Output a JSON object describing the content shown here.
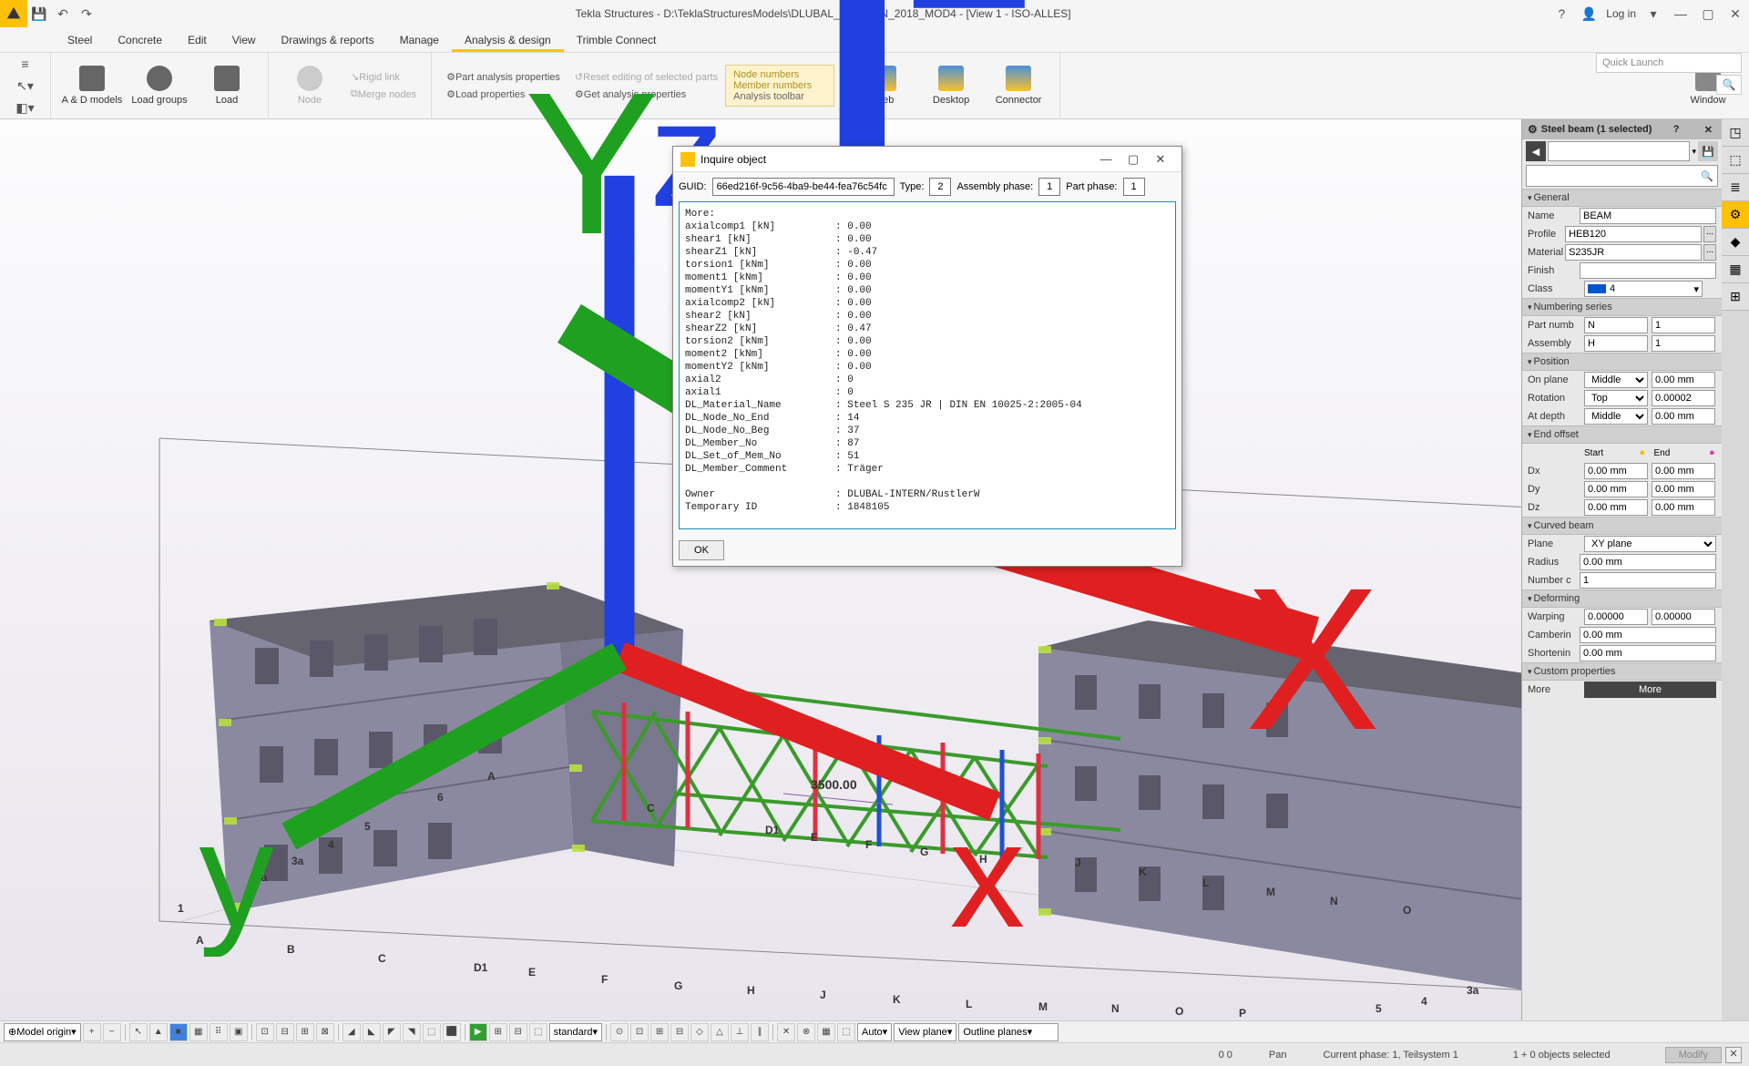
{
  "titlebar": {
    "title": "Tekla Structures - D:\\TeklaStructuresModels\\DLUBAL_SESSION_2018_MOD4 - [View 1 - ISO-ALLES]",
    "login": "Log in"
  },
  "menu": {
    "items": [
      "Steel",
      "Concrete",
      "Edit",
      "View",
      "Drawings & reports",
      "Manage",
      "Analysis & design",
      "Trimble Connect"
    ],
    "active": "Analysis & design"
  },
  "ribbon": {
    "ad_models": "A & D models",
    "load_groups": "Load groups",
    "load": "Load",
    "node": "Node",
    "rigid_link": "Rigid link",
    "merge_nodes": "Merge nodes",
    "part_analysis": "Part analysis properties",
    "load_props": "Load properties",
    "reset_editing": "Reset editing of selected parts",
    "get_analysis": "Get analysis properties",
    "node_numbers": "Node numbers",
    "member_numbers": "Member numbers",
    "analysis_tb": "Analysis toolbar",
    "web": "Web",
    "desktop": "Desktop",
    "connector": "Connector",
    "window": "Window",
    "quick_launch": "Quick Launch"
  },
  "dialog": {
    "title": "Inquire object",
    "guid_label": "GUID:",
    "guid": "66ed216f-9c56-4ba9-be44-fea76c54fc",
    "type_label": "Type:",
    "type": "2",
    "asm_label": "Assembly phase:",
    "asm": "1",
    "part_label": "Part phase:",
    "part": "1",
    "text": "More:\naxialcomp1 [kN]          : 0.00\nshear1 [kN]              : 0.00\nshearZ1 [kN]             : -0.47\ntorsion1 [kNm]           : 0.00\nmoment1 [kNm]            : 0.00\nmomentY1 [kNm]           : 0.00\naxialcomp2 [kN]          : 0.00\nshear2 [kN]              : 0.00\nshearZ2 [kN]             : 0.47\ntorsion2 [kNm]           : 0.00\nmoment2 [kNm]            : 0.00\nmomentY2 [kNm]           : 0.00\naxial2                   : 0\naxial1                   : 0\nDL_Material_Name         : Steel S 235 JR | DIN EN 10025-2:2005-04\nDL_Node_No_End           : 14\nDL_Node_No_Beg           : 37\nDL_Member_No             : 87\nDL_Set_of_Mem_No         : 51\nDL_Member_Comment        : Träger\n\nOwner                    : DLUBAL-INTERN/RustlerW\nTemporary ID             : 1848105",
    "ok": "OK"
  },
  "props": {
    "title": "Steel beam (1 selected)",
    "general": "General",
    "name_l": "Name",
    "name_v": "BEAM",
    "profile_l": "Profile",
    "profile_v": "HEB120",
    "material_l": "Material",
    "material_v": "S235JR",
    "finish_l": "Finish",
    "finish_v": "",
    "class_l": "Class",
    "class_v": "4",
    "numbering": "Numbering series",
    "partnum_l": "Part numb",
    "partnum_p": "N",
    "partnum_n": "1",
    "asm_l": "Assembly",
    "asm_p": "H",
    "asm_n": "1",
    "position": "Position",
    "onplane_l": "On plane",
    "onplane_v": "Middle",
    "onplane_n": "0.00 mm",
    "rotation_l": "Rotation",
    "rotation_v": "Top",
    "rotation_n": "0.00002",
    "atdepth_l": "At depth",
    "atdepth_v": "Middle",
    "atdepth_n": "0.00 mm",
    "endoffset": "End offset",
    "start": "Start",
    "end": "End",
    "dx": "Dx",
    "dy": "Dy",
    "dz": "Dz",
    "zero": "0.00 mm",
    "curved": "Curved beam",
    "plane_l": "Plane",
    "plane_v": "XY plane",
    "radius_l": "Radius",
    "radius_v": "0.00 mm",
    "numc_l": "Number c",
    "numc_v": "1",
    "deforming": "Deforming",
    "warping_l": "Warping",
    "warping_v": "0.00000",
    "camber_l": "Camberin",
    "camber_v": "0.00 mm",
    "short_l": "Shortenin",
    "short_v": "0.00 mm",
    "custom": "Custom properties",
    "more": "More",
    "more_btn": "More"
  },
  "bottom": {
    "model_origin": "Model origin",
    "standard": "standard",
    "auto": "Auto",
    "view_plane": "View plane",
    "outline_planes": "Outline planes"
  },
  "status": {
    "coords": "0       0",
    "pan": "Pan",
    "phase": "Current phase: 1, Teilsystem 1",
    "selected": "1 + 0 objects selected",
    "modify": "Modify"
  },
  "viewport": {
    "dim_label": "3500.00"
  }
}
